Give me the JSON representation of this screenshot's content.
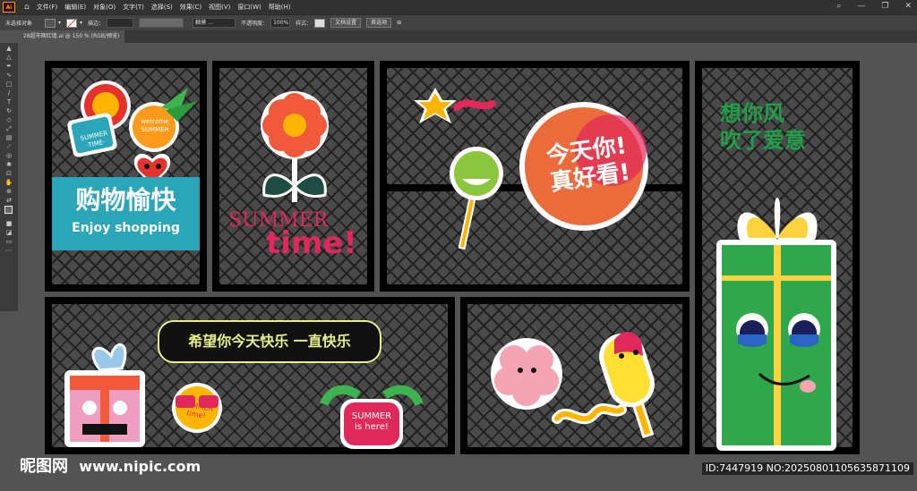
{
  "menubar": {
    "logo": "Ai",
    "items": [
      "文件(F)",
      "编辑(E)",
      "对象(O)",
      "文字(T)",
      "选择(S)",
      "效果(C)",
      "视图(V)",
      "窗口(W)",
      "帮助(H)"
    ]
  },
  "controlbar": {
    "selection": "未选择对象",
    "stroke_label": "描边：",
    "brush_label": "触摸 …",
    "opacity_label": "不透明度：",
    "opacity_value": "100%",
    "style_label": "样式：",
    "doc_setup": "文档设置",
    "preferences": "首选项"
  },
  "document": {
    "tab_title": "28超市网红墙.ai @ 150 % (RGB/预览)"
  },
  "artwork": {
    "sticker_summer_time": "SUMMER\n·TIME·",
    "sticker_welcome": "welcome\nSUMMER",
    "shopping_cn": "购物愉快",
    "shopping_en": "Enjoy shopping",
    "summer_pink_1": "SUMMER",
    "summer_pink_2": "time!",
    "today_line1": "今天你!",
    "today_line2": "真好看!",
    "miss_line1": "想你风",
    "miss_line2": "吹了爱意",
    "wish_banner": "希望你今天快乐 一直快乐",
    "summer_here_1": "SUMMER",
    "summer_here_2": "is here!",
    "summer_time_small_1": "SUMMER",
    "summer_time_small_2": "time!"
  },
  "watermark": {
    "brand": "昵图网",
    "url": "www.nipic.com",
    "id_info": "ID:7447919 NO:20250801105635871109"
  },
  "colors": {
    "accent_orange": "#ff9a00",
    "board_black": "#000000",
    "banner_teal": "#2aa6b8",
    "pink_text": "#e0285a",
    "green_text": "#1fa048",
    "pill_text": "#e8f08a"
  }
}
